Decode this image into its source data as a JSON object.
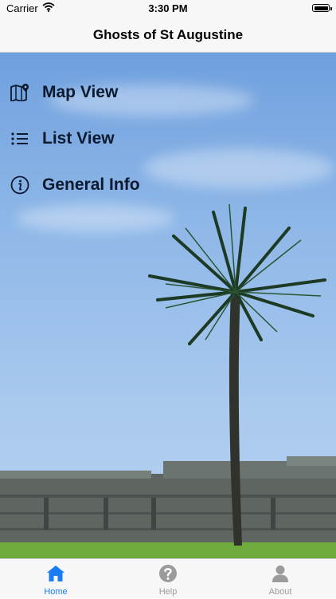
{
  "status_bar": {
    "carrier": "Carrier",
    "time": "3:30 PM"
  },
  "nav": {
    "title": "Ghosts of St Augustine"
  },
  "menu": [
    {
      "label": "Map View",
      "icon": "map-pin-icon"
    },
    {
      "label": "List View",
      "icon": "list-icon"
    },
    {
      "label": "General Info",
      "icon": "info-icon"
    }
  ],
  "tabs": [
    {
      "label": "Home",
      "icon": "home-icon",
      "selected": true
    },
    {
      "label": "Help",
      "icon": "help-icon",
      "selected": false
    },
    {
      "label": "About",
      "icon": "person-icon",
      "selected": false
    }
  ],
  "colors": {
    "accent": "#1a7cf5",
    "inactive": "#9b9b9b"
  }
}
